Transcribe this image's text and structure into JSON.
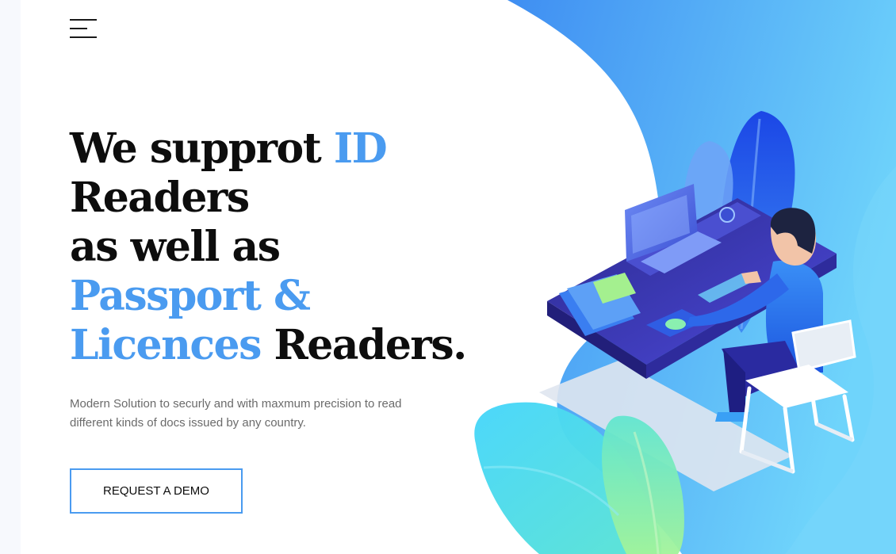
{
  "nav": {
    "menu_icon": "hamburger-menu-icon"
  },
  "hero": {
    "headline": {
      "line1_part1": "We supprot ",
      "line1_accent": "ID",
      "line2": "Readers",
      "line3": "as well as",
      "line4_accent": "Passport &",
      "line5_accent": "Licences",
      "line5_part2": " Readers."
    },
    "subtitle": "Modern Solution to securly and with maxmum precision to read different kinds of docs issued by any country.",
    "cta_label": "REQUEST A DEMO",
    "illustration": "person-at-laptop-illustration"
  },
  "colors": {
    "accent": "#4a9bf0",
    "text": "#0d0d0d",
    "muted": "#6b6b6b",
    "background": "#ffffff"
  }
}
